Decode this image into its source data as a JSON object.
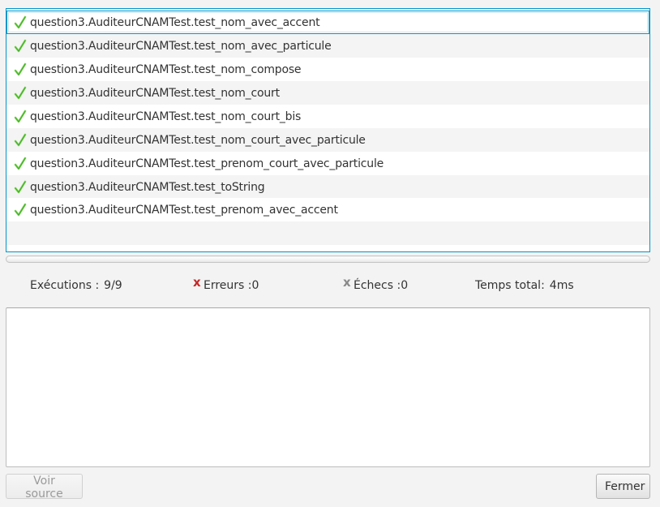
{
  "tests": [
    {
      "name": "question3.AuditeurCNAMTest.test_nom_avec_accent",
      "status": "passed",
      "selected": true
    },
    {
      "name": "question3.AuditeurCNAMTest.test_nom_avec_particule",
      "status": "passed"
    },
    {
      "name": "question3.AuditeurCNAMTest.test_nom_compose",
      "status": "passed"
    },
    {
      "name": "question3.AuditeurCNAMTest.test_nom_court",
      "status": "passed"
    },
    {
      "name": "question3.AuditeurCNAMTest.test_nom_court_bis",
      "status": "passed"
    },
    {
      "name": "question3.AuditeurCNAMTest.test_nom_court_avec_particule",
      "status": "passed"
    },
    {
      "name": "question3.AuditeurCNAMTest.test_prenom_court_avec_particule",
      "status": "passed"
    },
    {
      "name": "question3.AuditeurCNAMTest.test_toString",
      "status": "passed"
    },
    {
      "name": "question3.AuditeurCNAMTest.test_prenom_avec_accent",
      "status": "passed"
    }
  ],
  "stats": {
    "runs_label": "Exécutions :",
    "runs_value": "9/9",
    "errors_label": "Erreurs :0",
    "errors_icon": "x-icon",
    "failures_label": "Échecs :0",
    "failures_icon": "x-icon",
    "time_label": "Temps total:",
    "time_value": "4ms"
  },
  "trace": {
    "text": ""
  },
  "buttons": {
    "view_source": "Voir source",
    "close": "Fermer"
  },
  "colors": {
    "pass_check": "#4caf50",
    "error_x": "#c62828",
    "failure_x": "#8a8a8a",
    "selection_border": "#0096c9"
  }
}
